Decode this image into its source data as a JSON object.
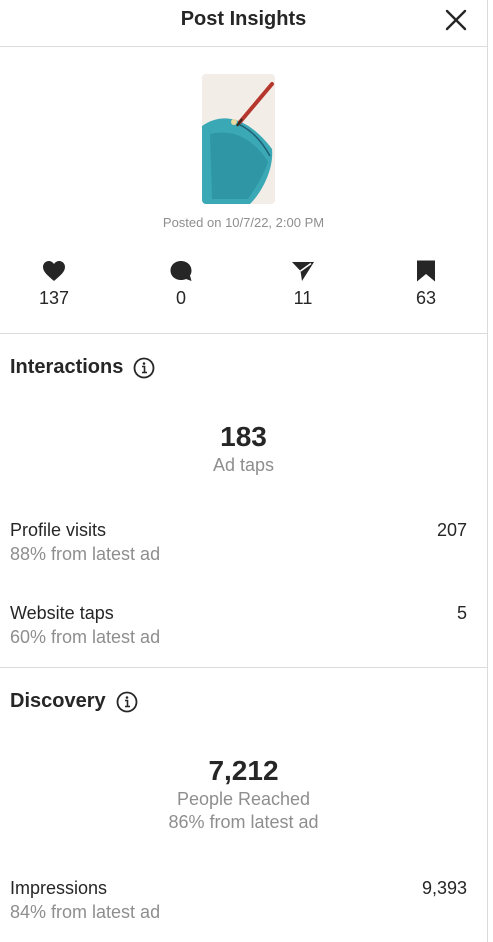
{
  "header": {
    "title": "Post Insights",
    "close_icon": "close-icon"
  },
  "post": {
    "posted_text": "Posted on 10/7/22, 2:00 PM",
    "thumbnail_colors": [
      "#f3ede8",
      "#3ba8b5",
      "#b5362c"
    ]
  },
  "stats": {
    "likes": {
      "icon": "heart-icon",
      "value": "137"
    },
    "comments": {
      "icon": "comment-icon",
      "value": "0"
    },
    "shares": {
      "icon": "send-icon",
      "value": "11"
    },
    "saves": {
      "icon": "bookmark-icon",
      "value": "63"
    }
  },
  "interactions": {
    "title": "Interactions",
    "info_icon": "info-icon",
    "metric_value": "183",
    "metric_label": "Ad taps",
    "rows": [
      {
        "label": "Profile visits",
        "sub": "88% from latest ad",
        "value": "207"
      },
      {
        "label": "Website taps",
        "sub": "60% from latest ad",
        "value": "5"
      }
    ]
  },
  "discovery": {
    "title": "Discovery",
    "info_icon": "info-icon",
    "metric_value": "7,212",
    "metric_label": "People Reached",
    "metric_sub": "86% from latest ad",
    "rows": [
      {
        "label": "Impressions",
        "sub": "84% from latest ad",
        "value": "9,393"
      }
    ]
  }
}
